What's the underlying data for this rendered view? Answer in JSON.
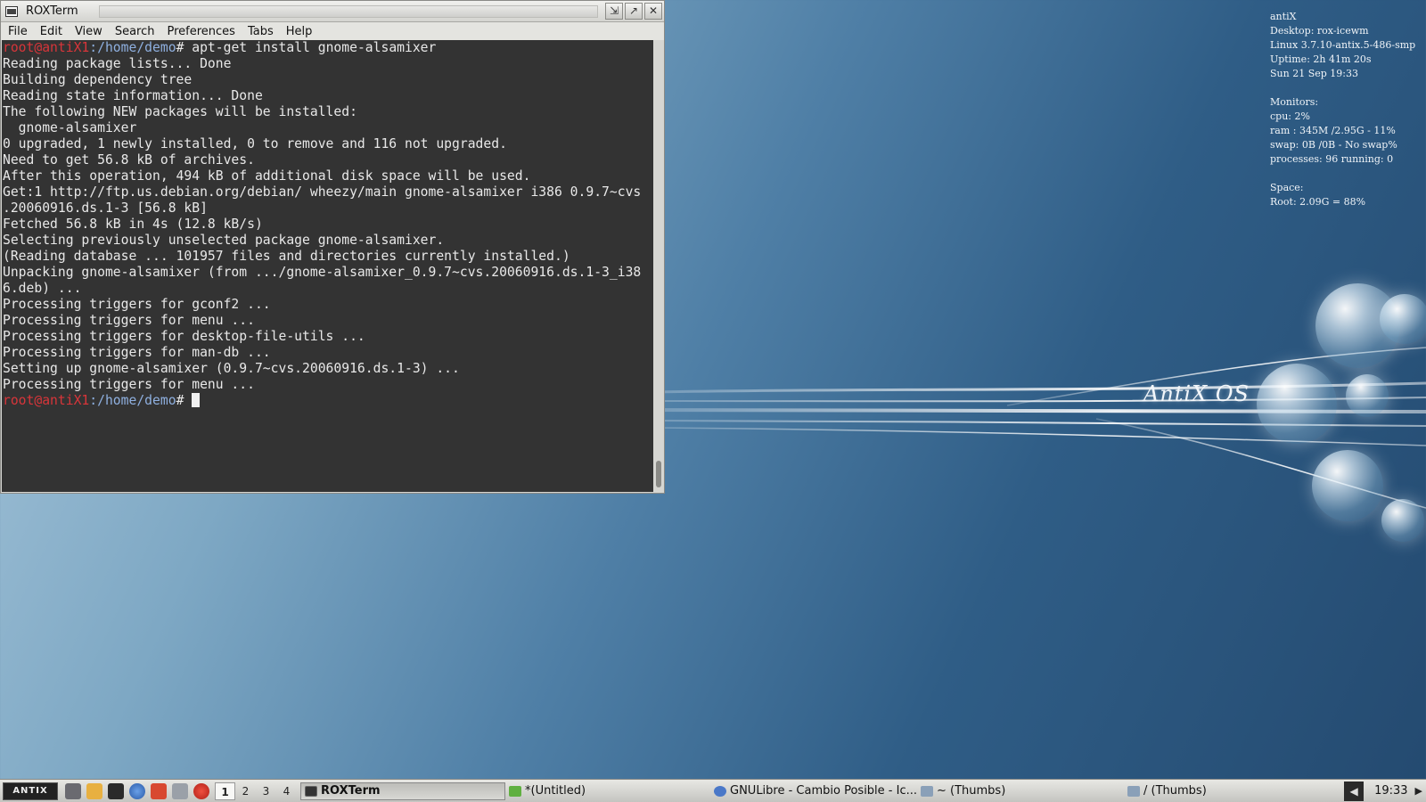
{
  "window": {
    "title": "ROXTerm",
    "menu": [
      "File",
      "Edit",
      "View",
      "Search",
      "Preferences",
      "Tabs",
      "Help"
    ]
  },
  "terminal": {
    "prompt_user": "root@antiX1",
    "prompt_path": ":/home/demo",
    "prompt_symbol": "# ",
    "command": "apt-get install gnome-alsamixer",
    "output": [
      "Reading package lists... Done",
      "Building dependency tree",
      "Reading state information... Done",
      "The following NEW packages will be installed:",
      "  gnome-alsamixer",
      "0 upgraded, 1 newly installed, 0 to remove and 116 not upgraded.",
      "Need to get 56.8 kB of archives.",
      "After this operation, 494 kB of additional disk space will be used.",
      "Get:1 http://ftp.us.debian.org/debian/ wheezy/main gnome-alsamixer i386 0.9.7~cvs",
      ".20060916.ds.1-3 [56.8 kB]",
      "Fetched 56.8 kB in 4s (12.8 kB/s)",
      "Selecting previously unselected package gnome-alsamixer.",
      "(Reading database ... 101957 files and directories currently installed.)",
      "Unpacking gnome-alsamixer (from .../gnome-alsamixer_0.9.7~cvs.20060916.ds.1-3_i38",
      "6.deb) ...",
      "Processing triggers for gconf2 ...",
      "Processing triggers for menu ...",
      "Processing triggers for desktop-file-utils ...",
      "Processing triggers for man-db ...",
      "Setting up gnome-alsamixer (0.9.7~cvs.20060916.ds.1-3) ...",
      "Processing triggers for menu ..."
    ]
  },
  "conky": {
    "hostname": "antiX",
    "desktop": "Desktop: rox-icewm",
    "kernel": "Linux 3.7.10-antix.5-486-smp",
    "uptime": "Uptime: 2h 41m 20s",
    "date": "Sun 21 Sep 19:33",
    "monitors_title": "Monitors:",
    "cpu": "cpu: 2%",
    "ram": "ram : 345M /2.95G - 11%",
    "swap": "swap: 0B   /0B    - No swap%",
    "processes": "processes: 96    running: 0",
    "space_title": "Space:",
    "root": "Root: 2.09G = 88%"
  },
  "wallpaper": {
    "brand": "AntiX OS"
  },
  "taskbar": {
    "start_label": "ANTIX",
    "workspaces": [
      "1",
      "2",
      "3",
      "4"
    ],
    "active_workspace": "1",
    "tasks": [
      {
        "label": "ROXTerm",
        "active": true
      },
      {
        "label": "*(Untitled)",
        "active": false
      },
      {
        "label": "GNULibre - Cambio Posible - Ic...",
        "active": false
      },
      {
        "label": "~ (Thumbs)",
        "active": false
      },
      {
        "label": "/ (Thumbs)",
        "active": false
      }
    ],
    "clock": "19:33"
  },
  "colors": {
    "prompt_user": "#d8353a",
    "prompt_path": "#8fb0e0",
    "terminal_bg": "#333333"
  }
}
